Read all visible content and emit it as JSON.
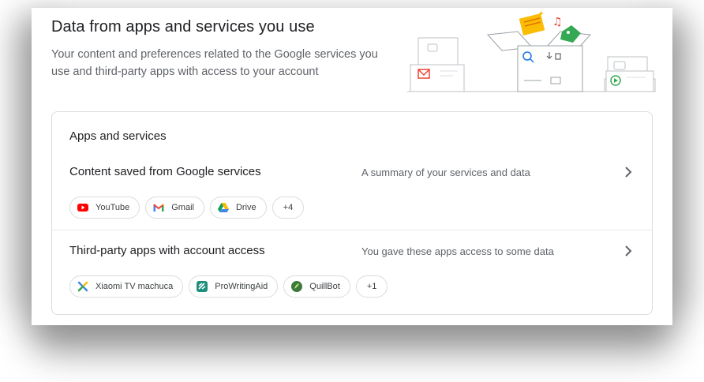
{
  "header": {
    "title": "Data from apps and services you use",
    "subtitle": "Your content and preferences related to the Google services you use and third-party apps with access to your account"
  },
  "card": {
    "title": "Apps and services",
    "rows": [
      {
        "title": "Content saved from Google services",
        "description": "A summary of your services and data",
        "chips": [
          {
            "label": "YouTube",
            "icon": "youtube-icon"
          },
          {
            "label": "Gmail",
            "icon": "gmail-icon"
          },
          {
            "label": "Drive",
            "icon": "drive-icon"
          }
        ],
        "more": "+4"
      },
      {
        "title": "Third-party apps with account access",
        "description": "You gave these apps access to some data",
        "chips": [
          {
            "label": "Xiaomi TV machuca",
            "icon": "xiaomi-tv-icon"
          },
          {
            "label": "ProWritingAid",
            "icon": "prowritingaid-icon"
          },
          {
            "label": "QuillBot",
            "icon": "quillbot-icon"
          }
        ],
        "more": "+1"
      }
    ]
  },
  "colors": {
    "accent_blue": "#1a73e8",
    "text_primary": "#202124",
    "text_secondary": "#5f6368",
    "border": "#dadce0"
  }
}
